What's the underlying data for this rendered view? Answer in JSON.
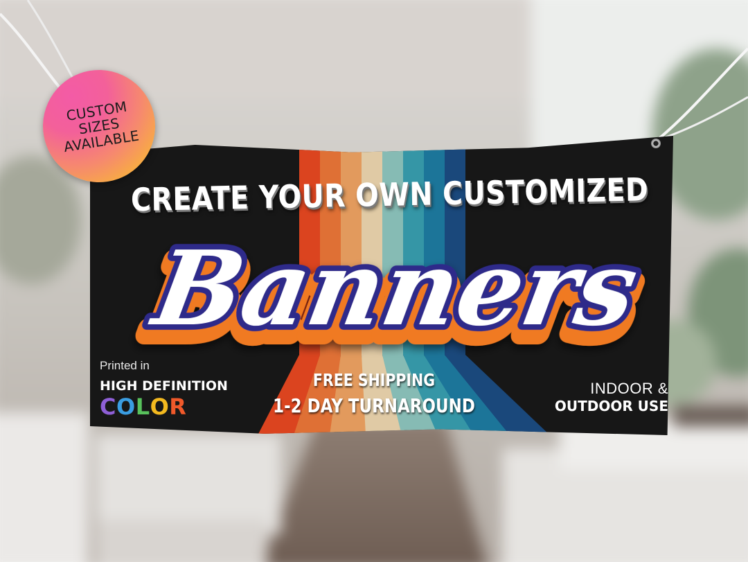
{
  "badge": {
    "lines": [
      "CUSTOM",
      "SIZES",
      "AVAILABLE"
    ],
    "gradient": [
      "#f35ba6",
      "#f68a6d",
      "#f9c224"
    ]
  },
  "banner": {
    "headline": "CREATE YOUR OWN CUSTOMIZED",
    "brand_word": "Banners",
    "left": {
      "printed_in": "Printed in",
      "hd": "HIGH DEFINITION",
      "color_letters": [
        {
          "char": "C",
          "color": "#8e5fd6"
        },
        {
          "char": "O",
          "color": "#3a9de1"
        },
        {
          "char": "L",
          "color": "#58c15c"
        },
        {
          "char": "O",
          "color": "#f3b91f"
        },
        {
          "char": "R",
          "color": "#f0592a"
        }
      ]
    },
    "center": {
      "line1": "FREE SHIPPING",
      "line2": "1-2 DAY TURNAROUND"
    },
    "right": {
      "line1": "INDOOR &",
      "line2": "OUTDOOR USE"
    },
    "stripe_colors": [
      "#ee4a22",
      "#f27a3a",
      "#f6a865",
      "#f3dcb3",
      "#92cbc4",
      "#3aa3b5",
      "#1f7fa6",
      "#1d4f86"
    ],
    "background": "#1a1a1a",
    "brand_colors": {
      "fill": "#ffffff",
      "outline": "#2d2a8a",
      "extrude": "#f07a20"
    }
  }
}
